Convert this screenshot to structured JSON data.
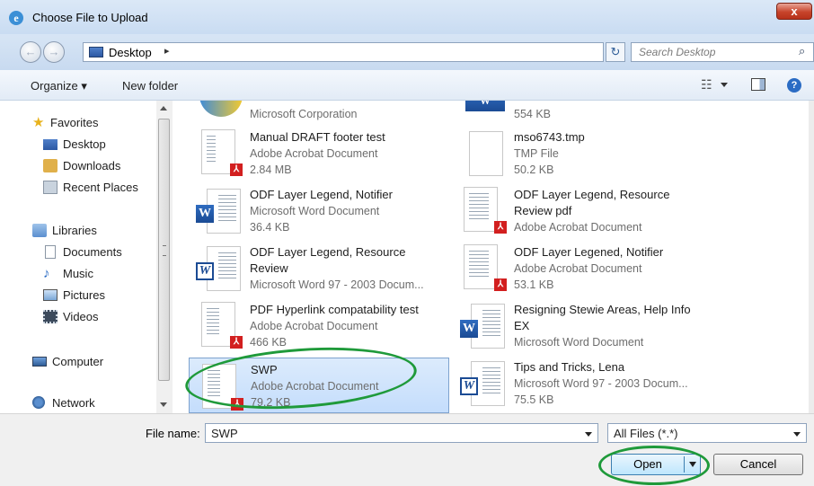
{
  "window": {
    "title": "Choose File to Upload",
    "close_label": "x"
  },
  "nav": {
    "back_label": "←",
    "forward_label": "→",
    "path_label": "Desktop",
    "path_chevron": "▸",
    "refresh_label": "↻",
    "search_placeholder": "Search Desktop",
    "search_icon": "⌕"
  },
  "toolbar": {
    "organize": "Organize ▾",
    "new_folder": "New folder",
    "help": "?",
    "views_icon": "☷"
  },
  "sidebar": {
    "items": [
      {
        "label": "Favorites"
      },
      {
        "label": "Desktop"
      },
      {
        "label": "Downloads"
      },
      {
        "label": "Recent Places"
      },
      {
        "label": "Libraries"
      },
      {
        "label": "Documents"
      },
      {
        "label": "Music"
      },
      {
        "label": "Pictures"
      },
      {
        "label": "Videos"
      },
      {
        "label": "Computer"
      },
      {
        "label": "Network"
      }
    ]
  },
  "files": {
    "left": [
      {
        "name": "",
        "meta1": "Microsoft Corporation",
        "meta2": ""
      },
      {
        "name": "Manual DRAFT footer test",
        "meta1": "Adobe Acrobat Document",
        "meta2": "2.84 MB"
      },
      {
        "name": "ODF Layer Legend, Notifier",
        "meta1": "Microsoft Word Document",
        "meta2": "36.4 KB"
      },
      {
        "name": "ODF Layer Legend, Resource",
        "name2": "Review",
        "meta1": "Microsoft Word 97 - 2003 Docum...",
        "meta2": ""
      },
      {
        "name": "PDF Hyperlink compatability test",
        "meta1": "Adobe Acrobat Document",
        "meta2": "466 KB"
      },
      {
        "name": "SWP",
        "meta1": "Adobe Acrobat Document",
        "meta2": "79.2 KB"
      }
    ],
    "right": [
      {
        "name": "",
        "meta1": "554 KB",
        "meta2": ""
      },
      {
        "name": "mso6743.tmp",
        "meta1": "TMP File",
        "meta2": "50.2 KB"
      },
      {
        "name": "ODF Layer Legend, Resource",
        "name2": "Review pdf",
        "meta1": "Adobe Acrobat Document",
        "meta2": ""
      },
      {
        "name": "ODF Layer Legened, Notifier",
        "meta1": "Adobe Acrobat Document",
        "meta2": "53.1 KB"
      },
      {
        "name": "Resigning Stewie Areas, Help Info",
        "name2": "EX",
        "meta1": "Microsoft Word Document",
        "meta2": ""
      },
      {
        "name": "Tips and Tricks, Lena",
        "meta1": "Microsoft Word 97 - 2003 Docum...",
        "meta2": "75.5 KB"
      }
    ]
  },
  "bottom": {
    "file_name_label": "File name:",
    "file_name_value": "SWP",
    "filter_value": "All Files (*.*)",
    "open_label": "Open",
    "cancel_label": "Cancel"
  },
  "colors": {
    "annotation": "#1f9a3a",
    "selection": "#c4ddfc"
  }
}
